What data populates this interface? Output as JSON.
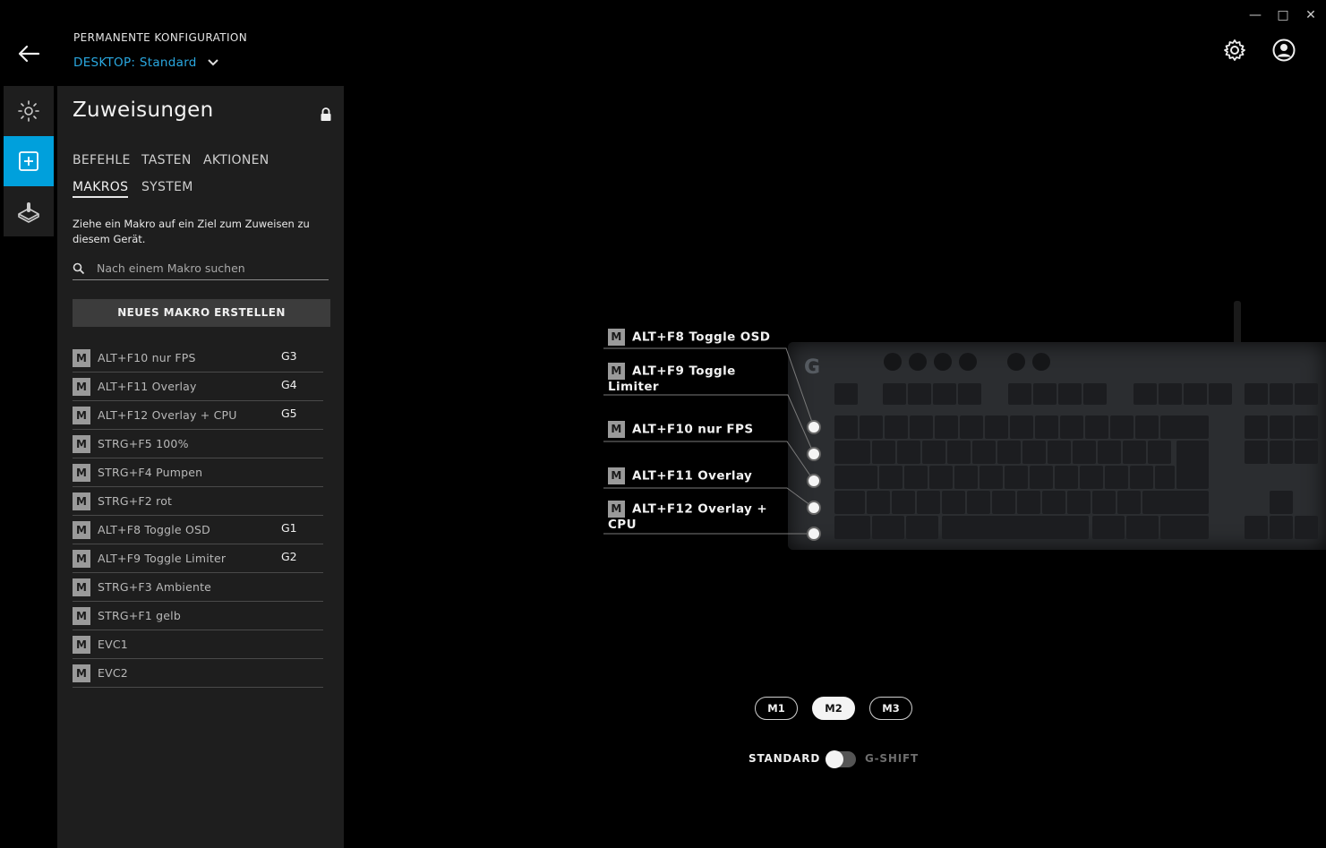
{
  "window": {
    "minimize": "—",
    "maximize": "□",
    "close": "✕"
  },
  "header": {
    "title": "PERMANENTE KONFIGURATION",
    "profile_label": "DESKTOP:",
    "profile_value": "Standard"
  },
  "rail": {
    "items": [
      "lighting-icon",
      "assignments-icon",
      "gaming-mode-icon"
    ],
    "active_index": 1
  },
  "panel": {
    "title": "Zuweisungen",
    "tabs_row1": [
      "BEFEHLE",
      "TASTEN",
      "AKTIONEN"
    ],
    "tabs_row2": [
      "MAKROS",
      "SYSTEM"
    ],
    "active_tab": "MAKROS",
    "hint": "Ziehe ein Makro auf ein Ziel zum Zuweisen zu diesem Gerät.",
    "search_placeholder": "Nach einem Makro suchen",
    "new_button": "NEUES MAKRO ERSTELLEN",
    "badge": "M",
    "macros": [
      {
        "name": "ALT+F10 nur FPS",
        "key": "G3"
      },
      {
        "name": "ALT+F11 Overlay",
        "key": "G4"
      },
      {
        "name": "ALT+F12 Overlay + CPU",
        "key": "G5"
      },
      {
        "name": "STRG+F5 100%",
        "key": ""
      },
      {
        "name": "STRG+F4 Pumpen",
        "key": ""
      },
      {
        "name": "STRG+F2 rot",
        "key": ""
      },
      {
        "name": "ALT+F8 Toggle OSD",
        "key": "G1"
      },
      {
        "name": "ALT+F9 Toggle Limiter",
        "key": "G2"
      },
      {
        "name": "STRG+F3 Ambiente",
        "key": ""
      },
      {
        "name": "STRG+F1 gelb",
        "key": ""
      },
      {
        "name": "EVC1",
        "key": ""
      },
      {
        "name": "EVC2",
        "key": ""
      }
    ]
  },
  "device": {
    "callouts": [
      {
        "badge": "M",
        "line1": "ALT+F8 Toggle OSD",
        "line2": ""
      },
      {
        "badge": "M",
        "line1": "ALT+F9 Toggle",
        "line2": "Limiter"
      },
      {
        "badge": "M",
        "line1": "ALT+F10 nur FPS",
        "line2": ""
      },
      {
        "badge": "M",
        "line1": "ALT+F11 Overlay",
        "line2": ""
      },
      {
        "badge": "M",
        "line1": "ALT+F12 Overlay +",
        "line2": "CPU"
      }
    ],
    "mode_buttons": [
      "M1",
      "M2",
      "M3"
    ],
    "active_mode": "M2",
    "toggle_left": "STANDARD",
    "toggle_right": "G-SHIFT",
    "toggle_state": "STANDARD"
  },
  "colors": {
    "accent": "#00a0dc",
    "profile_text": "#2aa8e0",
    "panel_bg": "#1e1e1e"
  }
}
